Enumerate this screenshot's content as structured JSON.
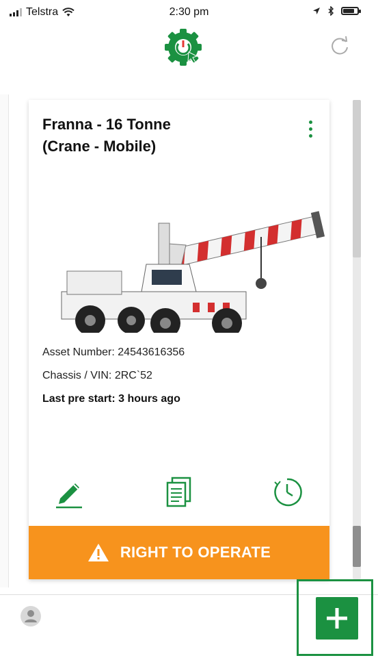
{
  "status_bar": {
    "carrier": "Telstra",
    "time": "2:30 pm"
  },
  "header": {
    "logo_icon": "gear-power-cursor-logo",
    "refresh_icon": "refresh-icon"
  },
  "asset_card": {
    "title_line1": "Franna - 16 Tonne",
    "title_line2": "(Crane - Mobile)",
    "asset_number_label": "Asset Number:",
    "asset_number_value": "24543616356",
    "chassis_label": "Chassis / VIN:",
    "chassis_value": "2RC`52",
    "last_prestart_label": "Last pre start:",
    "last_prestart_value": "3 hours ago",
    "actions": [
      "edit-icon",
      "documents-icon",
      "history-clock-icon"
    ],
    "right_to_operate_label": "RIGHT TO OPERATE"
  },
  "colors": {
    "brand_green": "#1b9141",
    "warning_orange": "#f7931d"
  }
}
